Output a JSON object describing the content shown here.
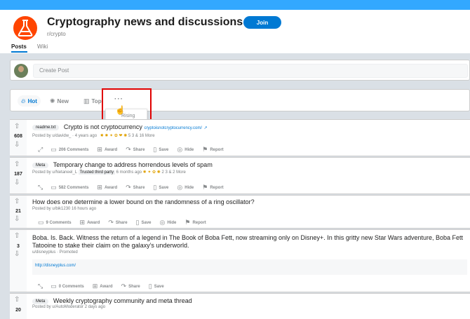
{
  "header": {
    "title": "Cryptography news and discussions",
    "subreddit": "r/crypto",
    "join_label": "Join",
    "tabs": [
      "Posts",
      "Wiki"
    ],
    "accent": "#0079d3",
    "icon_color": "#ff4500"
  },
  "create_post": {
    "placeholder": "Create Post"
  },
  "sort": {
    "hot": "Hot",
    "new": "New",
    "top": "Top",
    "more": "···",
    "dropdown_item": "Rising"
  },
  "posts": [
    {
      "votes": "608",
      "flair": "readme.txt",
      "title": "Crypto is not cryptocurrency",
      "link": "cryptoisnotcryptocurrency.com/",
      "meta": "Posted by u/davidw_ · 4 years ago",
      "awards": "5  3 & 16 More",
      "comments": "206 Comments",
      "award": "Award",
      "share": "Share",
      "save": "Save",
      "hide": "Hide",
      "report": "Report"
    },
    {
      "votes": "187",
      "flair": "Meta",
      "title": "Temporary change to address horrendous levels of spam",
      "meta_prefix": "Posted by u/Netaneel_L",
      "trusted": "Trusted third party",
      "meta_suffix": "6 months ago",
      "awards": "2  3  & 2 More",
      "comments": "582 Comments",
      "award": "Award",
      "share": "Share",
      "save": "Save",
      "hide": "Hide",
      "report": "Report"
    },
    {
      "votes": "21",
      "title": "How does one determine a lower bound on the randomness of a ring oscillator?",
      "meta": "Posted by u/bik1230 16 hours ago",
      "comments": "9 Comments",
      "award": "Award",
      "share": "Share",
      "save": "Save",
      "hide": "Hide",
      "report": "Report"
    },
    {
      "votes": "3",
      "title": "Boba. Is. Back. Witness the return of a legend in The Book of Boba Fett, now streaming only on Disney+. In this gritty new Star Wars adventure, Boba Fett",
      "title2": "Tatooine to stake their claim on the galaxy’s underworld.",
      "meta": "u/disneyplus · Promoted",
      "link": "http://disneyplus.com/",
      "comments": "0 Comments",
      "award": "Award",
      "share": "Share",
      "save": "Save"
    },
    {
      "votes": "20",
      "flair": "Meta",
      "title": "Weekly cryptography community and meta thread",
      "meta": "Posted by u/AutoModerator 2 days ago"
    }
  ]
}
